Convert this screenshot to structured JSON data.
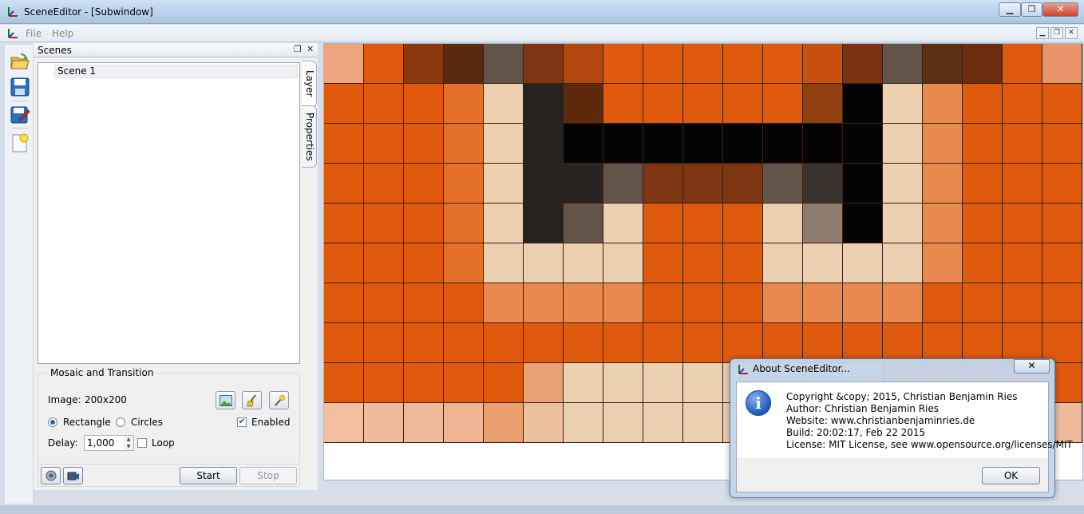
{
  "window": {
    "title": "SceneEditor - [Subwindow]",
    "minimize": "▁",
    "restore": "❐",
    "close": "✕"
  },
  "menu": {
    "file": "File",
    "help": "Help",
    "mdi_min": "▁",
    "mdi_restore": "❐",
    "mdi_close": "✕"
  },
  "dock": {
    "title": "Scenes",
    "float_icon": "❐",
    "close_icon": "✕",
    "scenes": [
      "Scene 1"
    ],
    "tabs": {
      "layer": "Layer",
      "properties": "Properties"
    }
  },
  "mosaic": {
    "group_title": "Mosaic and Transition",
    "image_label": "Image:",
    "image_value": "200x200",
    "rectangle_label": "Rectangle",
    "circles_label": "Circles",
    "enabled_label": "Enabled",
    "delay_label": "Delay:",
    "delay_value": "1,000",
    "loop_label": "Loop",
    "shape_selected": "Rectangle",
    "enabled_checked": true,
    "loop_checked": false
  },
  "controls": {
    "start": "Start",
    "stop": "Stop"
  },
  "mosaic_grid": {
    "rows": [
      [
        "#eda57e",
        "#e05a0d",
        "#8a380d",
        "#5c2a10",
        "#635449",
        "#7e3511",
        "#b0480f",
        "#e05a0d",
        "#e05a0d",
        "#e05a0d",
        "#e05a0d",
        "#e05a0d",
        "#c9500f",
        "#7a3210",
        "#635449",
        "#5b3116",
        "#6c2c0f",
        "#e05a0d",
        "#e8936a"
      ],
      [
        "#e05a0d",
        "#e05a0d",
        "#e05a0d",
        "#e5702c",
        "#ecd0b2",
        "#262320",
        "#5e2a0c",
        "#e05a0d",
        "#e05a0d",
        "#e05a0d",
        "#e05a0d",
        "#e05a0d",
        "#913e10",
        "#050404",
        "#ecd0b2",
        "#e9894f",
        "#e05a0d",
        "#e05a0d",
        "#e05a0d"
      ],
      [
        "#e05a0d",
        "#e05a0d",
        "#e05a0d",
        "#e5702c",
        "#ecd0b2",
        "#262320",
        "#050404",
        "#050404",
        "#050404",
        "#050404",
        "#050404",
        "#050404",
        "#050404",
        "#050404",
        "#ecd0b2",
        "#e9894f",
        "#e05a0d",
        "#e05a0d",
        "#e05a0d"
      ],
      [
        "#e05a0d",
        "#e05a0d",
        "#e05a0d",
        "#e5702c",
        "#ecd0b2",
        "#262320",
        "#262320",
        "#635449",
        "#7e3511",
        "#7e3511",
        "#7e3511",
        "#635449",
        "#3a322d",
        "#050404",
        "#ecd0b2",
        "#e9894f",
        "#e05a0d",
        "#e05a0d",
        "#e05a0d"
      ],
      [
        "#e05a0d",
        "#e05a0d",
        "#e05a0d",
        "#e5702c",
        "#ecd0b2",
        "#262320",
        "#635449",
        "#ecd0b2",
        "#e05a0d",
        "#e05a0d",
        "#e05a0d",
        "#ecd0b2",
        "#8e7d6e",
        "#050404",
        "#ecd0b2",
        "#e9894f",
        "#e05a0d",
        "#e05a0d",
        "#e05a0d"
      ],
      [
        "#e05a0d",
        "#e05a0d",
        "#e05a0d",
        "#e5702c",
        "#ecd0b2",
        "#ecd0b2",
        "#ecd0b2",
        "#ecd0b2",
        "#e05a0d",
        "#e05a0d",
        "#e05a0d",
        "#ecd0b2",
        "#ecd0b2",
        "#ecd0b2",
        "#ecd0b2",
        "#e9894f",
        "#e05a0d",
        "#e05a0d",
        "#e05a0d"
      ],
      [
        "#e05a0d",
        "#e05a0d",
        "#e05a0d",
        "#e05a0d",
        "#e9894f",
        "#e9894f",
        "#e9894f",
        "#e9894f",
        "#e05a0d",
        "#e05a0d",
        "#e05a0d",
        "#e9894f",
        "#e9894f",
        "#e9894f",
        "#e9894f",
        "#e05a0d",
        "#e05a0d",
        "#e05a0d",
        "#e05a0d"
      ],
      [
        "#e05a0d",
        "#e05a0d",
        "#e05a0d",
        "#e05a0d",
        "#e05a0d",
        "#e05a0d",
        "#e05a0d",
        "#e05a0d",
        "#e05a0d",
        "#e05a0d",
        "#e05a0d",
        "#e05a0d",
        "#e05a0d",
        "#e05a0d",
        "#e05a0d",
        "#e05a0d",
        "#e05a0d",
        "#e05a0d",
        "#e05a0d"
      ],
      [
        "#e05a0d",
        "#e05a0d",
        "#e05a0d",
        "#e05a0d",
        "#e05a0d",
        "#e8a273",
        "#ecd0b2",
        "#ecd0b2",
        "#ecd0b2",
        "#ecd0b2",
        "#ecd0b2",
        "#ecd0b2",
        "#ecd0b2",
        "#ecd0b2",
        "#e05a0d",
        "#e05a0d",
        "#e05a0d",
        "#e05a0d",
        "#e05a0d"
      ],
      [
        "#f2bea0",
        "#f0bb9c",
        "#f0bb9c",
        "#f0b592",
        "#eaa06e",
        "#ecc09c",
        "#ecd0b2",
        "#ecd0b2",
        "#ecd0b2",
        "#ecd0b2",
        "#ecd0b2",
        "#ecd0b2",
        "#ecd0b2",
        "#ecd0b2",
        "#ecd0b2",
        "#ecd0b2",
        "#ecd0b2",
        "#ecd0b2",
        "#f0bb9c"
      ]
    ]
  },
  "about": {
    "title": "About SceneEditor...",
    "close": "✕",
    "lines": [
      "Copyright &copy; 2015, Christian Benjamin Ries",
      "Author: Christian Benjamin Ries",
      "Website: www.christianbenjaminries.de",
      "Build: 20:02:17, Feb 22 2015",
      "License: MIT License, see www.opensource.org/licenses/MIT"
    ],
    "ok": "OK",
    "info_glyph": "i"
  },
  "icons": {
    "app": "app-axes-icon",
    "open": "folder-open-icon",
    "save": "save-icon",
    "save_as": "save-as-icon",
    "new": "new-document-icon",
    "image": "image-icon",
    "broom": "clear-icon",
    "wand": "wand-icon"
  }
}
